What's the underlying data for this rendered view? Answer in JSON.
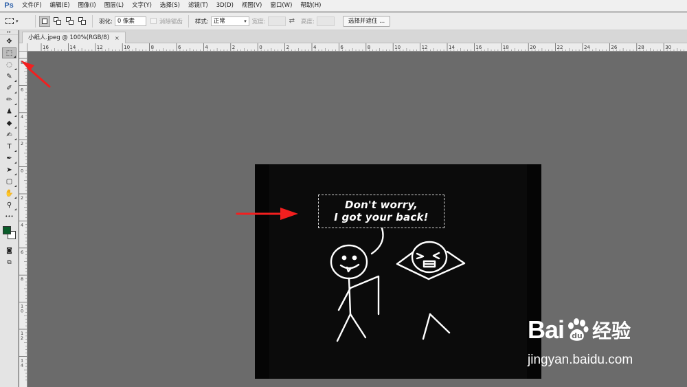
{
  "app": {
    "logo": "Ps",
    "accent": "#2b5ea8"
  },
  "menu": [
    {
      "label": "文件(F)"
    },
    {
      "label": "编辑(E)"
    },
    {
      "label": "图像(I)"
    },
    {
      "label": "图层(L)"
    },
    {
      "label": "文字(Y)"
    },
    {
      "label": "选择(S)"
    },
    {
      "label": "滤镜(T)"
    },
    {
      "label": "3D(D)"
    },
    {
      "label": "视图(V)"
    },
    {
      "label": "窗口(W)"
    },
    {
      "label": "帮助(H)"
    }
  ],
  "options": {
    "feather_label": "羽化:",
    "feather_value": "0 像素",
    "antialias_label": "消除锯齿",
    "style_label": "样式:",
    "style_value": "正常",
    "width_label": "宽度:",
    "height_label": "高度:",
    "select_mask_label": "选择并遮住 ..."
  },
  "tools": [
    {
      "name": "move-tool",
      "glyph": "✥",
      "active": false
    },
    {
      "name": "rect-marquee-tool",
      "glyph": "⬚",
      "active": true
    },
    {
      "name": "lasso-tool",
      "glyph": "◌",
      "active": false
    },
    {
      "name": "quick-select-tool",
      "glyph": "✎",
      "active": false
    },
    {
      "name": "eyedropper-tool",
      "glyph": "✐",
      "active": false
    },
    {
      "name": "brush-tool",
      "glyph": "✏",
      "active": false
    },
    {
      "name": "stamp-tool",
      "glyph": "♟",
      "active": false
    },
    {
      "name": "eraser-tool",
      "glyph": "◆",
      "active": false
    },
    {
      "name": "history-brush-tool",
      "glyph": "✍",
      "active": false
    },
    {
      "name": "type-tool",
      "glyph": "T",
      "active": false
    },
    {
      "name": "pen-tool",
      "glyph": "✒",
      "active": false
    },
    {
      "name": "path-select-tool",
      "glyph": "➤",
      "active": false
    },
    {
      "name": "shape-tool",
      "glyph": "▢",
      "active": false
    },
    {
      "name": "hand-tool",
      "glyph": "✋",
      "active": false
    },
    {
      "name": "zoom-tool",
      "glyph": "⚲",
      "active": false
    },
    {
      "name": "more-tools",
      "glyph": "•••",
      "active": false
    }
  ],
  "colors": {
    "foreground": "#0a5c2a",
    "background": "#ffffff"
  },
  "document": {
    "tab_title": "小纸人.jpeg @ 100%(RGB/8)",
    "close_glyph": "×",
    "bubble_line1": "Don't worry,",
    "bubble_line2": "I got your back!"
  },
  "ruler_h_labels": [
    "16",
    "14",
    "12",
    "10",
    "8",
    "6",
    "4",
    "2",
    "0",
    "2",
    "4",
    "6",
    "8",
    "10",
    "12",
    "14",
    "16",
    "18",
    "20",
    "22",
    "24",
    "26",
    "28",
    "30"
  ],
  "ruler_v_labels": [
    "8",
    "6",
    "4",
    "2",
    "0",
    "2",
    "4",
    "6",
    "8",
    "1\n0",
    "1\n2",
    "1\n4"
  ],
  "watermark": {
    "brand_a": "Bai",
    "brand_b": "经验",
    "url": "jingyan.baidu.com"
  }
}
